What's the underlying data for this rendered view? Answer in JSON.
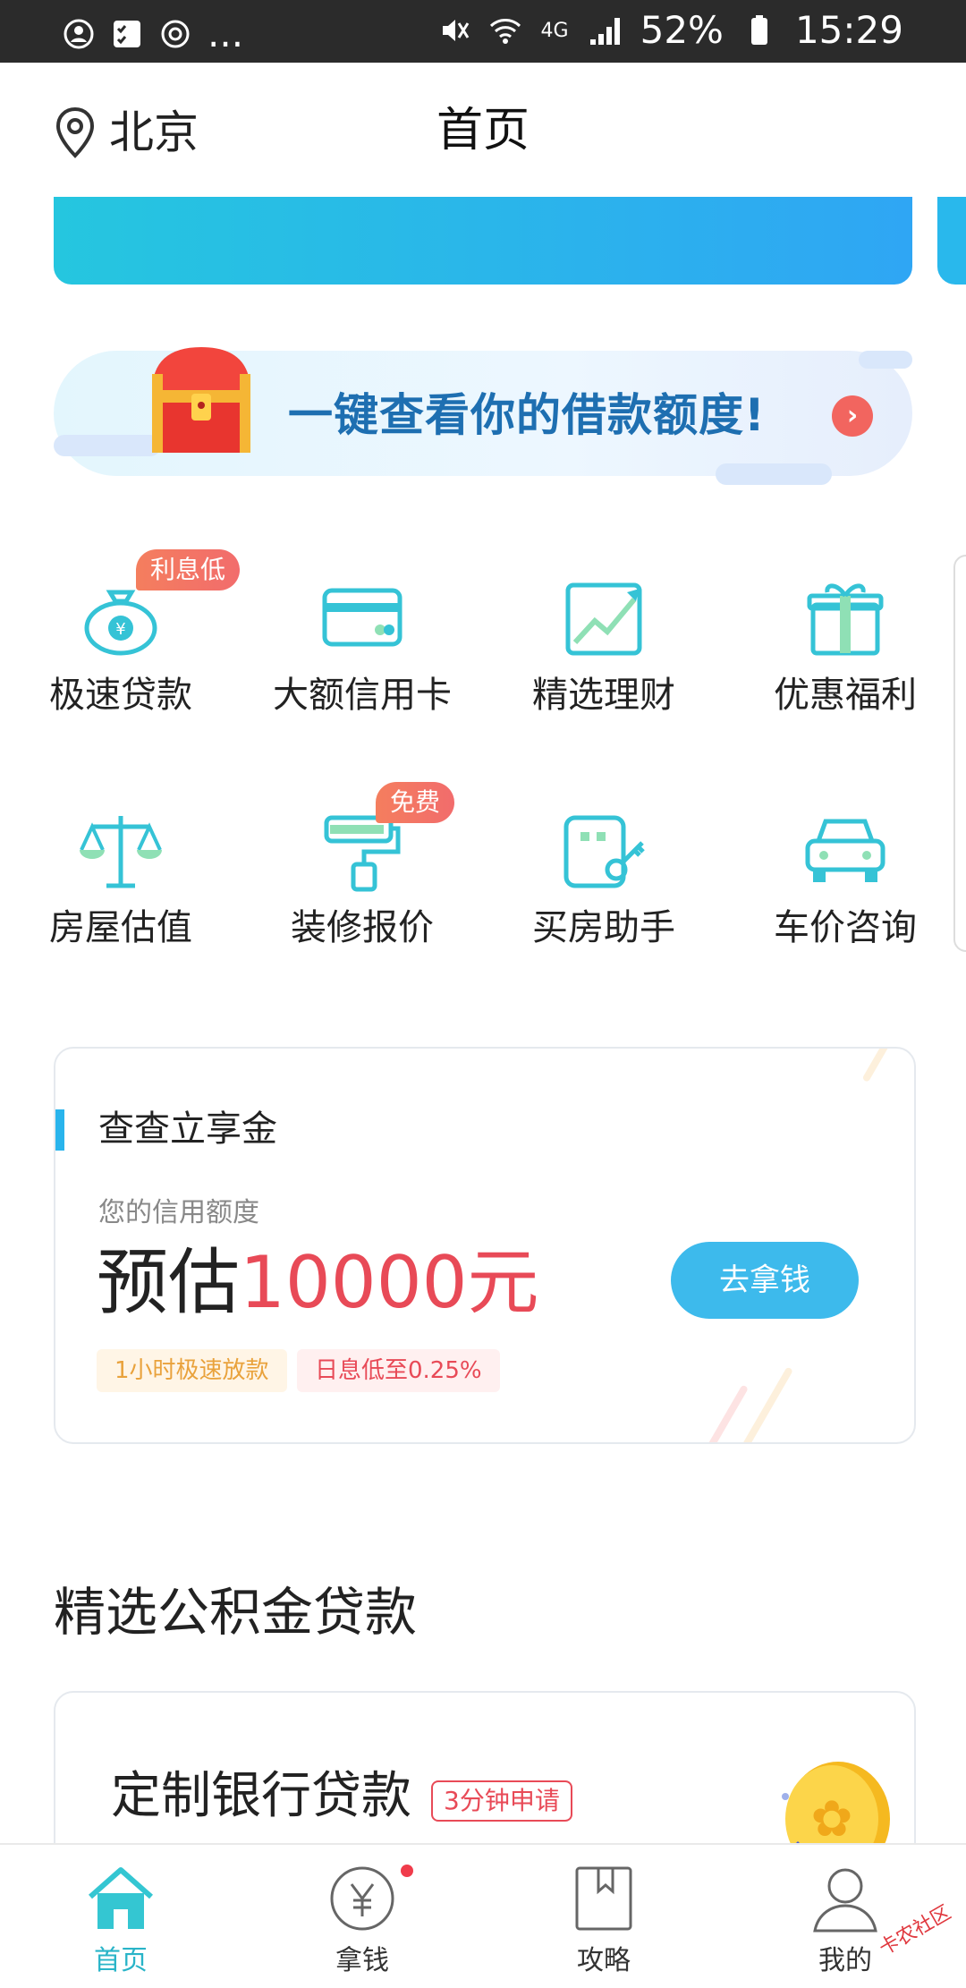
{
  "status_bar": {
    "dots": "...",
    "network": "4G",
    "battery": "52%",
    "time": "15:29"
  },
  "header": {
    "city": "北京",
    "title": "首页"
  },
  "credit_banner": {
    "text": "一键查看你的借款额度!"
  },
  "grid": [
    {
      "label": "极速贷款",
      "badge": "利息低",
      "icon": "money-bag-icon"
    },
    {
      "label": "大额信用卡",
      "badge": "",
      "icon": "credit-card-icon"
    },
    {
      "label": "精选理财",
      "badge": "",
      "icon": "trend-chart-icon"
    },
    {
      "label": "优惠福利",
      "badge": "",
      "icon": "gift-icon"
    },
    {
      "label": "房屋估值",
      "badge": "",
      "icon": "scale-icon"
    },
    {
      "label": "装修报价",
      "badge": "免费",
      "icon": "paint-roller-icon"
    },
    {
      "label": "买房助手",
      "badge": "",
      "icon": "house-key-icon"
    },
    {
      "label": "车价咨询",
      "badge": "",
      "icon": "car-icon"
    }
  ],
  "credit_card": {
    "title": "查查立享金",
    "subtitle": "您的信用额度",
    "estimate_prefix": "预估",
    "amount": "10000元",
    "button": "去拿钱",
    "tags": [
      "1小时极速放款",
      "日息低至0.25%"
    ]
  },
  "section": {
    "title": "精选公积金贷款"
  },
  "loan_card": {
    "title": "定制银行贷款",
    "tag": "3分钟申请"
  },
  "bottom_nav": [
    {
      "label": "首页",
      "active": true
    },
    {
      "label": "拿钱",
      "active": false
    },
    {
      "label": "攻略",
      "active": false
    },
    {
      "label": "我的",
      "active": false
    }
  ],
  "watermark": "卡农社区",
  "colors": {
    "accent": "#29b4ec",
    "amount": "#e84a57",
    "badge": "#f26c6c",
    "status_bar": "#2b2b2b"
  }
}
